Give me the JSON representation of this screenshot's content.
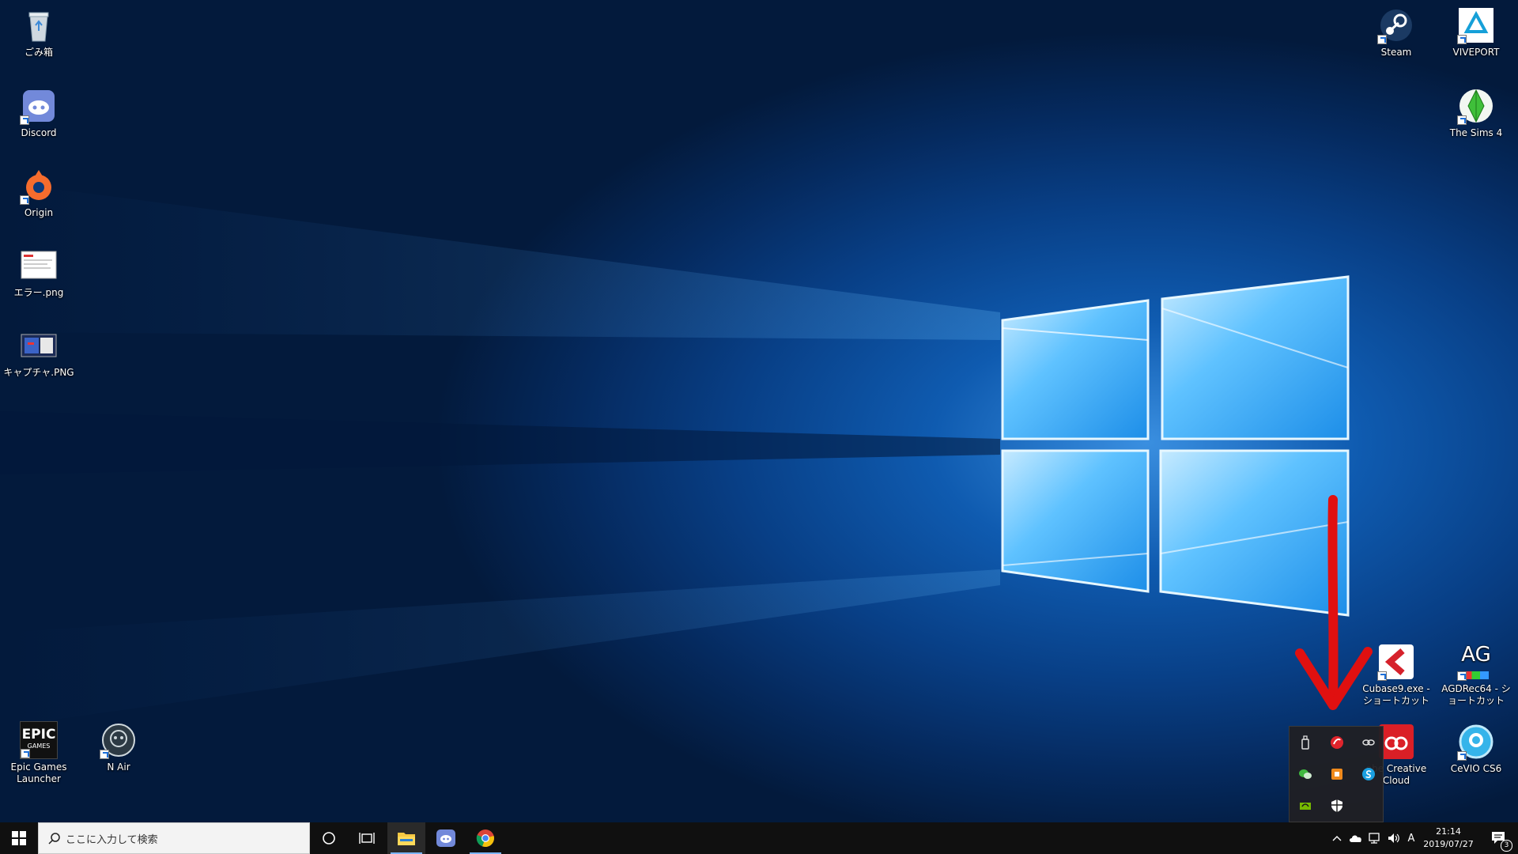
{
  "desktop": {
    "left_icons": [
      {
        "label": "ごみ箱",
        "icon": "recycle-bin-icon"
      },
      {
        "label": "Discord",
        "icon": "discord-icon"
      },
      {
        "label": "Origin",
        "icon": "origin-icon"
      },
      {
        "label": "エラー.png",
        "icon": "image-file-icon"
      },
      {
        "label": "キャプチャ.PNG",
        "icon": "image-file-icon"
      }
    ],
    "bottom_left_icons": [
      {
        "label": "Epic Games Launcher",
        "icon": "epic-games-icon",
        "logo_text": "EPIC",
        "logo_sub": "GAMES"
      },
      {
        "label": "N Air",
        "icon": "n-air-icon"
      }
    ],
    "right_icons": [
      {
        "label": "Steam",
        "icon": "steam-icon"
      },
      {
        "label": "VIVEPORT",
        "icon": "viveport-icon"
      },
      {
        "label": "The Sims 4",
        "icon": "sims-plumbob-icon"
      },
      {
        "label": "Cubase9.exe - ショートカット",
        "icon": "cubase-icon"
      },
      {
        "label": "AGDRec64 - ショートカット",
        "icon": "agdrec-icon",
        "logo_text": "AG"
      },
      {
        "label": "obe Creative Cloud",
        "icon": "creative-cloud-icon"
      },
      {
        "label": "CeVIO CS6",
        "icon": "cevio-icon"
      }
    ]
  },
  "annotation": {
    "type": "red-arrow",
    "color": "#e01010"
  },
  "tray_popup": {
    "items": [
      {
        "icon": "usb-drive-icon"
      },
      {
        "icon": "red-app-icon"
      },
      {
        "icon": "link-icon"
      },
      {
        "icon": "wechat-icon"
      },
      {
        "icon": "orange-app-icon"
      },
      {
        "icon": "skype-icon"
      },
      {
        "icon": "nvidia-icon"
      },
      {
        "icon": "security-shield-icon"
      }
    ]
  },
  "taskbar": {
    "start_icon": "windows-start-icon",
    "search": {
      "placeholder": "ここに入力して検索",
      "icon": "search-icon"
    },
    "cortana_icon": "cortana-icon",
    "task_view_icon": "task-view-icon",
    "pinned": [
      {
        "name": "file-explorer",
        "icon": "folder-icon",
        "active": true
      },
      {
        "name": "discord",
        "icon": "discord-icon",
        "active": false
      },
      {
        "name": "chrome",
        "icon": "chrome-icon",
        "active": true
      }
    ],
    "system_tray": {
      "chevron_icon": "chevron-up-icon",
      "onedrive_icon": "cloud-icon",
      "network_icon": "network-icon",
      "volume_icon": "speaker-icon",
      "ime": "A",
      "time": "21:14",
      "date": "2019/07/27",
      "notification_count": "3"
    }
  },
  "colors": {
    "taskbar": "#101010",
    "accent": "#0078d7",
    "arrow": "#e01010"
  }
}
